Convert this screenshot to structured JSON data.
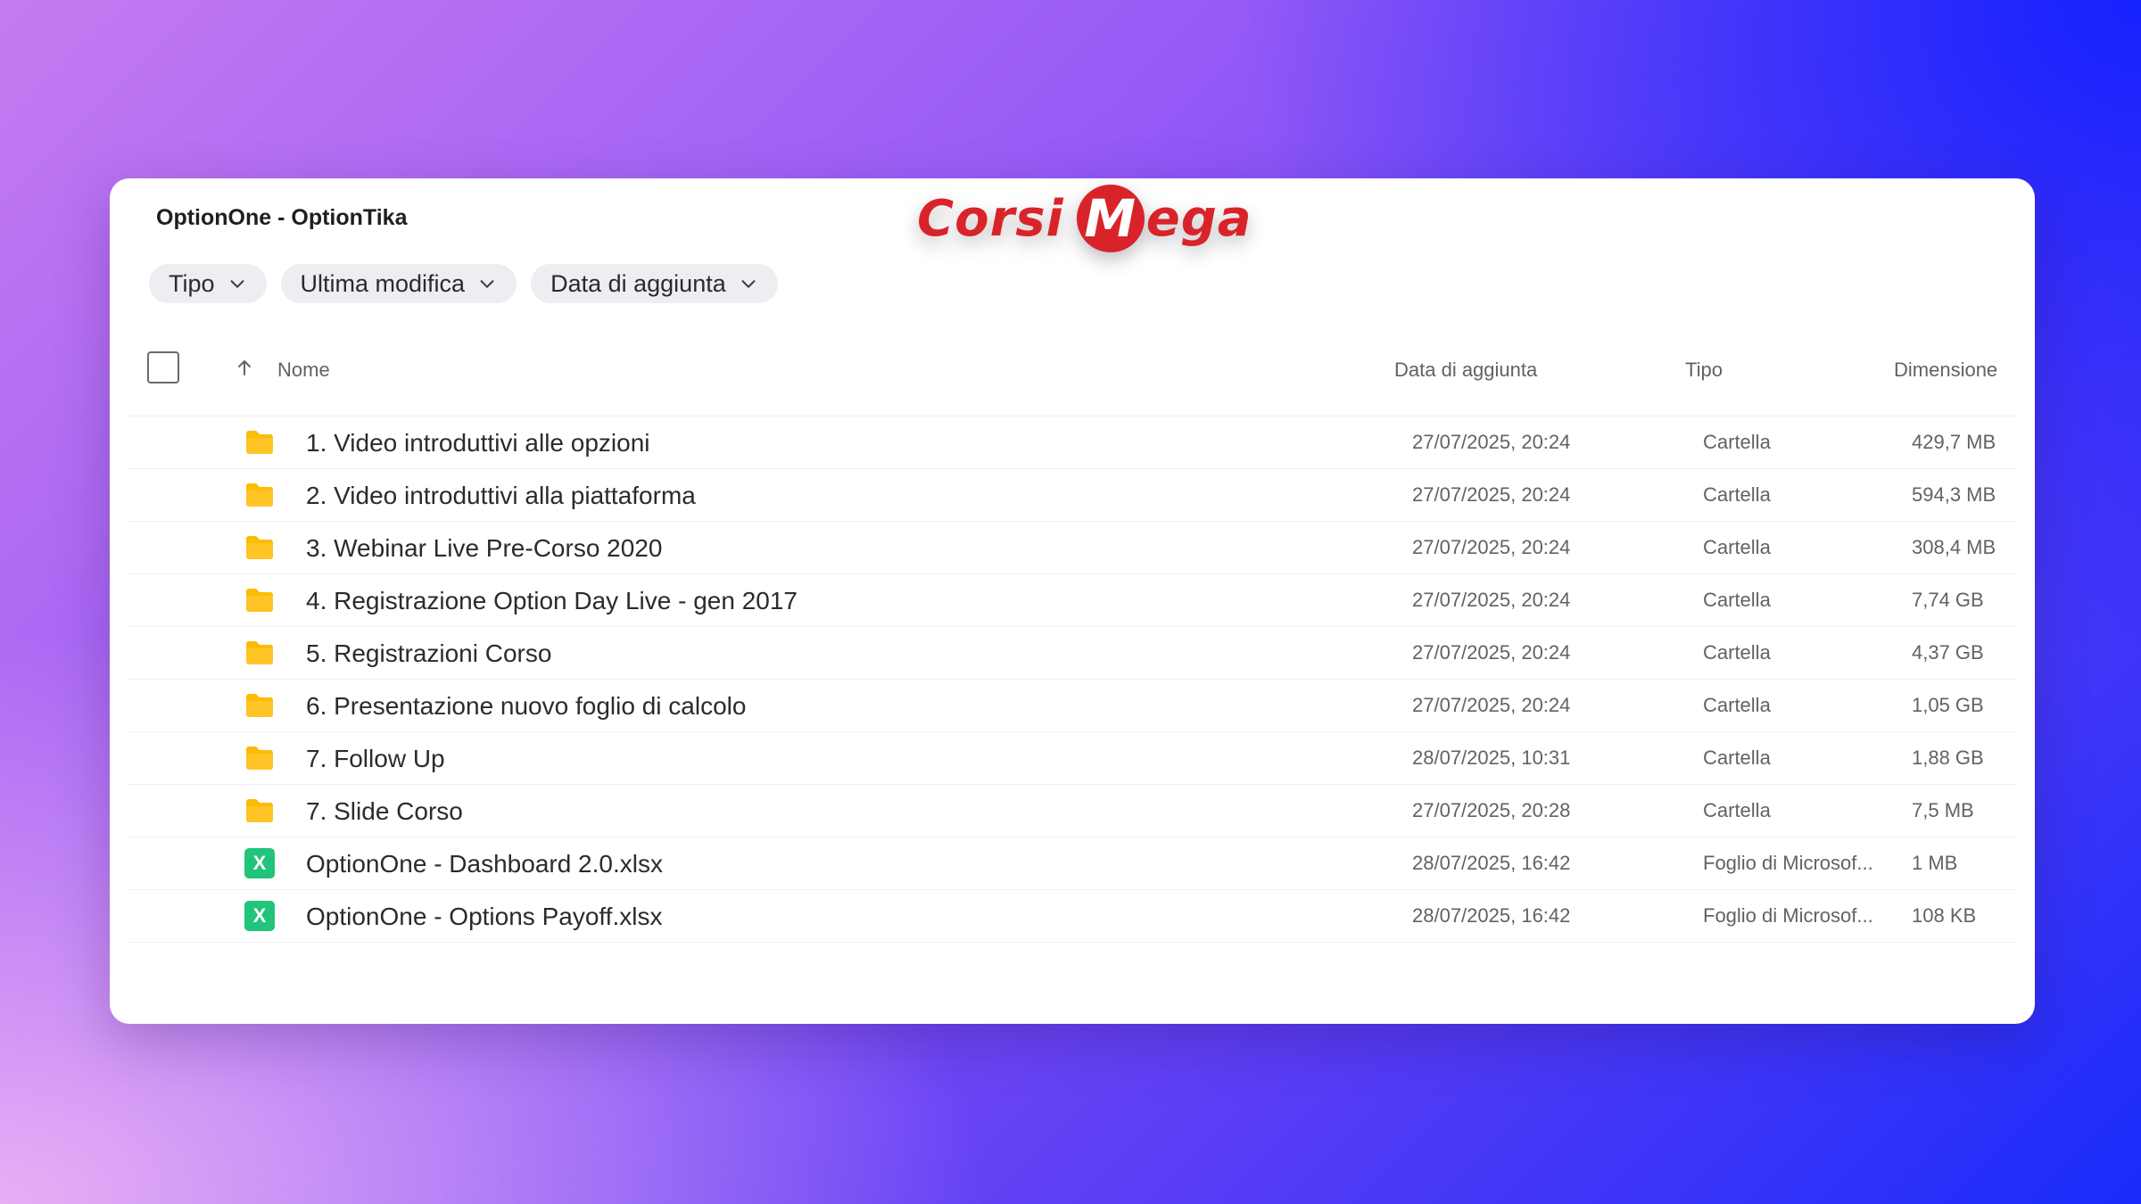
{
  "page_title": "OptionOne - OptionTika",
  "logo": {
    "part1": "Corsi",
    "part2_initial": "M",
    "part2_rest": "ega"
  },
  "filters": [
    {
      "label": "Tipo"
    },
    {
      "label": "Ultima modifica"
    },
    {
      "label": "Data di aggiunta"
    }
  ],
  "columns": {
    "name": "Nome",
    "date": "Data di aggiunta",
    "type": "Tipo",
    "size": "Dimensione"
  },
  "rows": [
    {
      "icon": "folder-icon",
      "name": "1. Video introduttivi alle opzioni",
      "date": "27/07/2025, 20:24",
      "type": "Cartella",
      "size": "429,7 MB"
    },
    {
      "icon": "folder-icon",
      "name": "2. Video introduttivi alla piattaforma",
      "date": "27/07/2025, 20:24",
      "type": "Cartella",
      "size": "594,3 MB"
    },
    {
      "icon": "folder-icon",
      "name": "3. Webinar Live Pre-Corso 2020",
      "date": "27/07/2025, 20:24",
      "type": "Cartella",
      "size": "308,4 MB"
    },
    {
      "icon": "folder-icon",
      "name": "4. Registrazione Option Day Live - gen 2017",
      "date": "27/07/2025, 20:24",
      "type": "Cartella",
      "size": "7,74 GB"
    },
    {
      "icon": "folder-icon",
      "name": "5. Registrazioni Corso",
      "date": "27/07/2025, 20:24",
      "type": "Cartella",
      "size": "4,37 GB"
    },
    {
      "icon": "folder-icon",
      "name": "6. Presentazione nuovo foglio di calcolo",
      "date": "27/07/2025, 20:24",
      "type": "Cartella",
      "size": "1,05 GB"
    },
    {
      "icon": "folder-icon",
      "name": "7. Follow Up",
      "date": "28/07/2025, 10:31",
      "type": "Cartella",
      "size": "1,88 GB"
    },
    {
      "icon": "folder-icon",
      "name": "7. Slide Corso",
      "date": "27/07/2025, 20:28",
      "type": "Cartella",
      "size": "7,5 MB"
    },
    {
      "icon": "excel-icon",
      "icon_letter": "X",
      "name": "OptionOne - Dashboard 2.0.xlsx",
      "date": "28/07/2025, 16:42",
      "type": "Foglio di Microsof...",
      "size": "1 MB"
    },
    {
      "icon": "excel-icon",
      "icon_letter": "X",
      "name": "OptionOne - Options Payoff.xlsx",
      "date": "28/07/2025, 16:42",
      "type": "Foglio di Microsof...",
      "size": "108 KB"
    }
  ],
  "colors": {
    "folder": "#fbbc04",
    "excel": "#21c47a",
    "logo_red": "#d9232a"
  }
}
